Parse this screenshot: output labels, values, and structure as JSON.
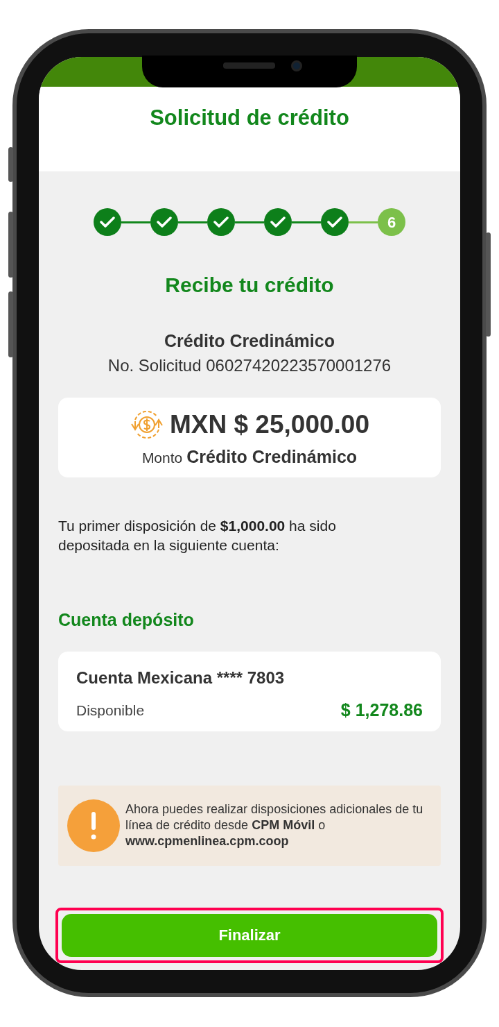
{
  "header": {
    "title": "Solicitud de crédito"
  },
  "steps": [
    {
      "done": true
    },
    {
      "done": true
    },
    {
      "done": true
    },
    {
      "done": true
    },
    {
      "done": true
    },
    {
      "done": false,
      "label": "6"
    }
  ],
  "heading": "Recibe tu crédito",
  "product": {
    "name": "Crédito Credinámico",
    "request": "No. Solicitud 06027420223570001276"
  },
  "amount_card": {
    "amount": "MXN $ 25,000.00",
    "caption_prefix": "Monto",
    "caption_name": "Crédito Credinámico"
  },
  "message": "Tu primer disposición de **$1,000.00** ha sido depositada en la siguiente cuenta:",
  "account_section": {
    "title": "Cuenta depósito",
    "account": "Cuenta Mexicana **** 7803",
    "available_label": "Disponible",
    "available_amount": "$ 1,278.86"
  },
  "notice": "Ahora puedes realizar disposiciones adicionales de tu línea de crédito desde **CPM Móvil** o **www.cpmenlinea.cpm.coop**",
  "finish_button": {
    "label": "Finalizar",
    "highlighted": true
  }
}
